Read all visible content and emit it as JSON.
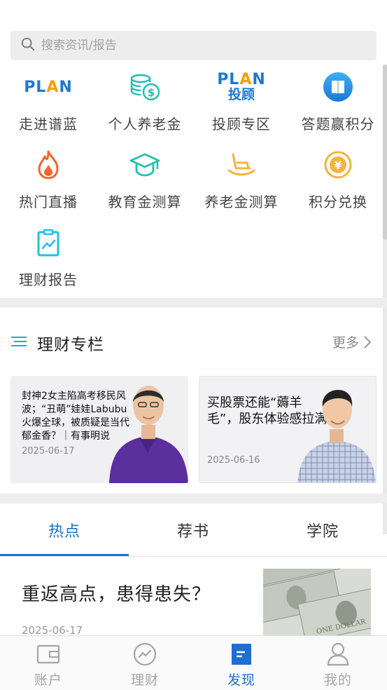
{
  "search": {
    "placeholder": "搜索资讯/报告"
  },
  "grid": [
    {
      "label": "走进谱蓝",
      "icon": "plan-logo-icon"
    },
    {
      "label": "个人养老金",
      "icon": "coins-dollar-icon"
    },
    {
      "label": "投顾专区",
      "icon": "plan-advisor-logo-icon",
      "logo_sub": "投顾"
    },
    {
      "label": "答题赢积分",
      "icon": "book-icon"
    },
    {
      "label": "热门直播",
      "icon": "flame-icon"
    },
    {
      "label": "教育金测算",
      "icon": "graduation-cap-icon"
    },
    {
      "label": "养老金测算",
      "icon": "rocking-chair-icon"
    },
    {
      "label": "积分兑换",
      "icon": "yen-coin-icon"
    },
    {
      "label": "理财报告",
      "icon": "report-clipboard-icon"
    }
  ],
  "logo_text": {
    "p": "PL",
    "a": "A",
    "n": "N"
  },
  "column": {
    "title": "理财专栏",
    "more": "更多"
  },
  "cards": [
    {
      "title": "封神2女主陷高考移民风波；“丑萌”娃娃Labubu火爆全球，被质疑是当代郁金香？｜有事明说",
      "date": "2025-06-17"
    },
    {
      "title": "买股票还能“薅羊毛”，股东体验感拉满",
      "date": "2025-06-16"
    }
  ],
  "tabs": [
    {
      "label": "热点",
      "active": true
    },
    {
      "label": "荐书",
      "active": false
    },
    {
      "label": "学院",
      "active": false
    }
  ],
  "article": {
    "title": "重返高点，患得患失？",
    "date": "2025-06-17"
  },
  "nav": [
    {
      "label": "账户",
      "icon": "wallet-icon",
      "active": false
    },
    {
      "label": "理财",
      "icon": "trend-chart-icon",
      "active": false
    },
    {
      "label": "发现",
      "icon": "discover-doc-icon",
      "active": true
    },
    {
      "label": "我的",
      "icon": "person-icon",
      "active": false
    }
  ],
  "colors": {
    "accent": "#1f6fd1",
    "teal": "#1fc1b2",
    "orange": "#f4a100"
  }
}
